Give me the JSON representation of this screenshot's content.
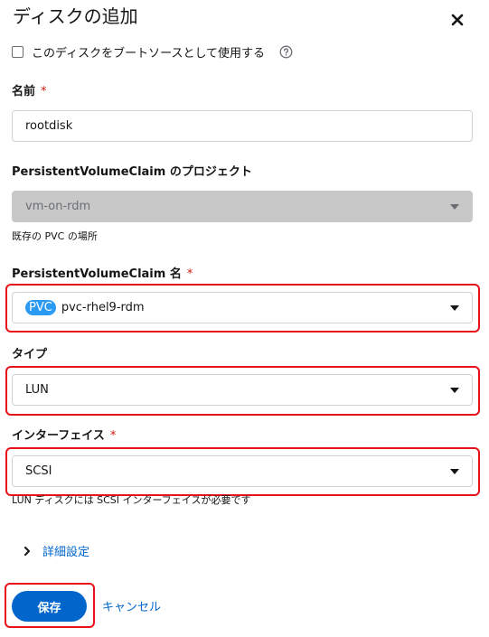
{
  "modal": {
    "title": "ディスクの追加",
    "close_icon": "close-icon"
  },
  "boot_source": {
    "label": "このディスクをブートソースとして使用する",
    "checked": false,
    "help_icon": "help-circle-icon"
  },
  "name_field": {
    "label": "名前",
    "required_mark": "*",
    "value": "rootdisk"
  },
  "pvc_project": {
    "label": "PersistentVolumeClaim のプロジェクト",
    "value": "vm-on-rdm",
    "helper": "既存の PVC の場所",
    "disabled": true
  },
  "pvc_name": {
    "label": "PersistentVolumeClaim 名",
    "required_mark": "*",
    "badge": "PVC",
    "value": "pvc-rhel9-rdm"
  },
  "type_field": {
    "label": "タイプ",
    "value": "LUN"
  },
  "interface_field": {
    "label": "インターフェイス",
    "required_mark": "*",
    "value": "SCSI",
    "helper": "LUN ディスクには SCSI インターフェイスが必要です"
  },
  "advanced": {
    "label": "詳細設定",
    "icon": "chevron-right-icon"
  },
  "actions": {
    "save_label": "保存",
    "cancel_label": "キャンセル"
  },
  "colors": {
    "primary": "#0066cc",
    "required": "#c9190b",
    "highlight": "#e8111a",
    "badge": "#2b9af3"
  }
}
